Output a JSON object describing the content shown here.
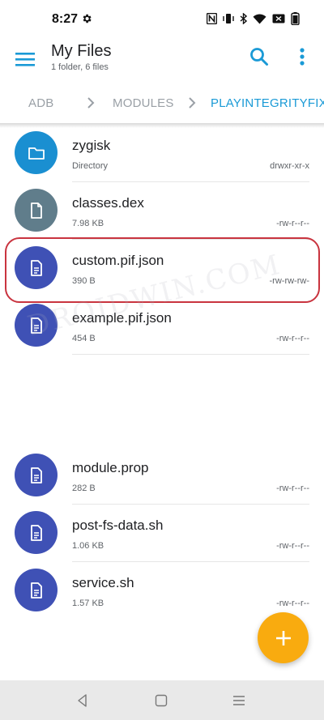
{
  "status_bar": {
    "time": "8:27"
  },
  "app_bar": {
    "title": "My Files",
    "subtitle": "1 folder, 6 files"
  },
  "breadcrumb": {
    "items": [
      "ADB",
      "MODULES",
      "PLAYINTEGRITYFIX"
    ]
  },
  "files": [
    {
      "name": "zygisk",
      "meta": "Directory",
      "perm": "drwxr-xr-x",
      "kind": "folder",
      "color": "#1a8fd1"
    },
    {
      "name": "classes.dex",
      "meta": "7.98 KB",
      "perm": "-rw-r--r--",
      "kind": "file",
      "color": "#607d8b"
    },
    {
      "name": "custom.pif.json",
      "meta": "390 B",
      "perm": "-rw-rw-rw-",
      "kind": "doc",
      "color": "#3f51b5"
    },
    {
      "name": "example.pif.json",
      "meta": "454 B",
      "perm": "-rw-r--r--",
      "kind": "doc",
      "color": "#3f51b5"
    },
    {
      "name": "module.prop",
      "meta": "282 B",
      "perm": "-rw-r--r--",
      "kind": "doc",
      "color": "#3f51b5"
    },
    {
      "name": "post-fs-data.sh",
      "meta": "1.06 KB",
      "perm": "-rw-r--r--",
      "kind": "doc",
      "color": "#3f51b5"
    },
    {
      "name": "service.sh",
      "meta": "1.57 KB",
      "perm": "-rw-r--r--",
      "kind": "doc",
      "color": "#3f51b5"
    }
  ],
  "watermark": "DROIDWIN.COM",
  "colors": {
    "accent": "#1a9ad6",
    "fab": "#f9ab0f",
    "highlight": "#c9343f"
  },
  "icons": {
    "menu": "hamburger-menu-icon",
    "search": "search-icon",
    "more": "more-vert-icon",
    "fab": "plus-icon",
    "nav": [
      "back-icon",
      "home-icon",
      "recents-icon"
    ]
  }
}
